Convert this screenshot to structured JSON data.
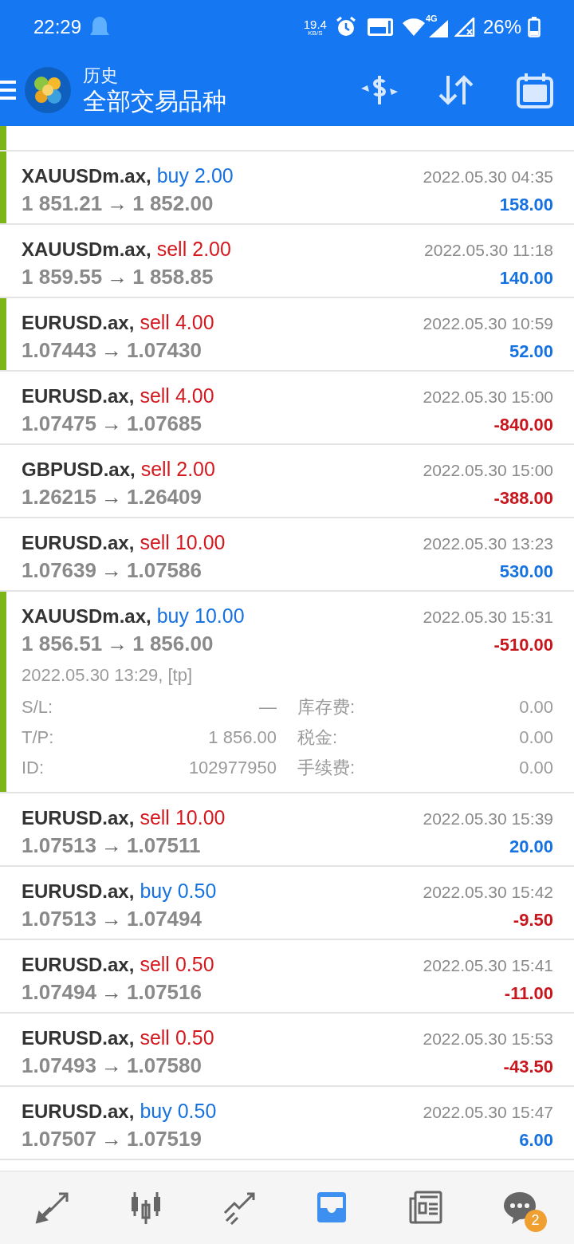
{
  "status_bar": {
    "time": "22:29",
    "speed": "19.4",
    "speed_unit": "KB/S",
    "network": "4G",
    "battery": "26%"
  },
  "header": {
    "subtitle": "历史",
    "title": "全部交易品种"
  },
  "deals": [
    {
      "highlighted": true
    },
    {
      "symbol": "XAUUSDm.ax,",
      "side": "buy",
      "volume": "2.00",
      "open": "1 851.21",
      "close": "1 852.00",
      "arrow": "→",
      "time": "2022.05.30 04:35",
      "profit": "158.00",
      "highlighted": true
    },
    {
      "symbol": "XAUUSDm.ax,",
      "side": "sell",
      "volume": "2.00",
      "open": "1 859.55",
      "close": "1 858.85",
      "arrow": "→",
      "time": "2022.05.30 11:18",
      "profit": "140.00",
      "highlighted": false
    },
    {
      "symbol": "EURUSD.ax,",
      "side": "sell",
      "volume": "4.00",
      "open": "1.07443",
      "close": "1.07430",
      "arrow": "→",
      "time": "2022.05.30 10:59",
      "profit": "52.00",
      "highlighted": true
    },
    {
      "symbol": "EURUSD.ax,",
      "side": "sell",
      "volume": "4.00",
      "open": "1.07475",
      "close": "1.07685",
      "arrow": "→",
      "time": "2022.05.30 15:00",
      "profit": "-840.00",
      "highlighted": false
    },
    {
      "symbol": "GBPUSD.ax,",
      "side": "sell",
      "volume": "2.00",
      "open": "1.26215",
      "close": "1.26409",
      "arrow": "→",
      "time": "2022.05.30 15:00",
      "profit": "-388.00",
      "highlighted": false
    },
    {
      "symbol": "EURUSD.ax,",
      "side": "sell",
      "volume": "10.00",
      "open": "1.07639",
      "close": "1.07586",
      "arrow": "→",
      "time": "2022.05.30 13:23",
      "profit": "530.00",
      "highlighted": false
    },
    {
      "symbol": "XAUUSDm.ax,",
      "side": "buy",
      "volume": "10.00",
      "open": "1 856.51",
      "close": "1 856.00",
      "arrow": "→",
      "time": "2022.05.30 15:31",
      "profit": "-510.00",
      "highlighted": true,
      "detail": {
        "open_time": "2022.05.30 13:29, [tp]",
        "fields": [
          {
            "label": "S/L:",
            "value": "—",
            "label2": "库存费:",
            "value2": "0.00"
          },
          {
            "label": "T/P:",
            "value": "1 856.00",
            "label2": "税金:",
            "value2": "0.00"
          },
          {
            "label": "ID:",
            "value": "102977950",
            "label2": "手续费:",
            "value2": "0.00"
          }
        ]
      }
    },
    {
      "symbol": "EURUSD.ax,",
      "side": "sell",
      "volume": "10.00",
      "open": "1.07513",
      "close": "1.07511",
      "arrow": "→",
      "time": "2022.05.30 15:39",
      "profit": "20.00",
      "highlighted": false
    },
    {
      "symbol": "EURUSD.ax,",
      "side": "buy",
      "volume": "0.50",
      "open": "1.07513",
      "close": "1.07494",
      "arrow": "→",
      "time": "2022.05.30 15:42",
      "profit": "-9.50",
      "highlighted": false
    },
    {
      "symbol": "EURUSD.ax,",
      "side": "sell",
      "volume": "0.50",
      "open": "1.07494",
      "close": "1.07516",
      "arrow": "→",
      "time": "2022.05.30 15:41",
      "profit": "-11.00",
      "highlighted": false
    },
    {
      "symbol": "EURUSD.ax,",
      "side": "sell",
      "volume": "0.50",
      "open": "1.07493",
      "close": "1.07580",
      "arrow": "→",
      "time": "2022.05.30 15:53",
      "profit": "-43.50",
      "highlighted": false
    },
    {
      "symbol": "EURUSD.ax,",
      "side": "buy",
      "volume": "0.50",
      "open": "1.07507",
      "close": "1.07519",
      "arrow": "→",
      "time": "2022.05.30 15:47",
      "profit": "6.00",
      "highlighted": false
    }
  ],
  "nav": [
    {
      "kind": "trade",
      "selected": false
    },
    {
      "kind": "quotes",
      "selected": false
    },
    {
      "kind": "chart",
      "selected": false
    },
    {
      "kind": "history",
      "selected": true
    },
    {
      "kind": "news",
      "selected": false
    },
    {
      "kind": "chat",
      "selected": false,
      "badge": "2"
    }
  ]
}
